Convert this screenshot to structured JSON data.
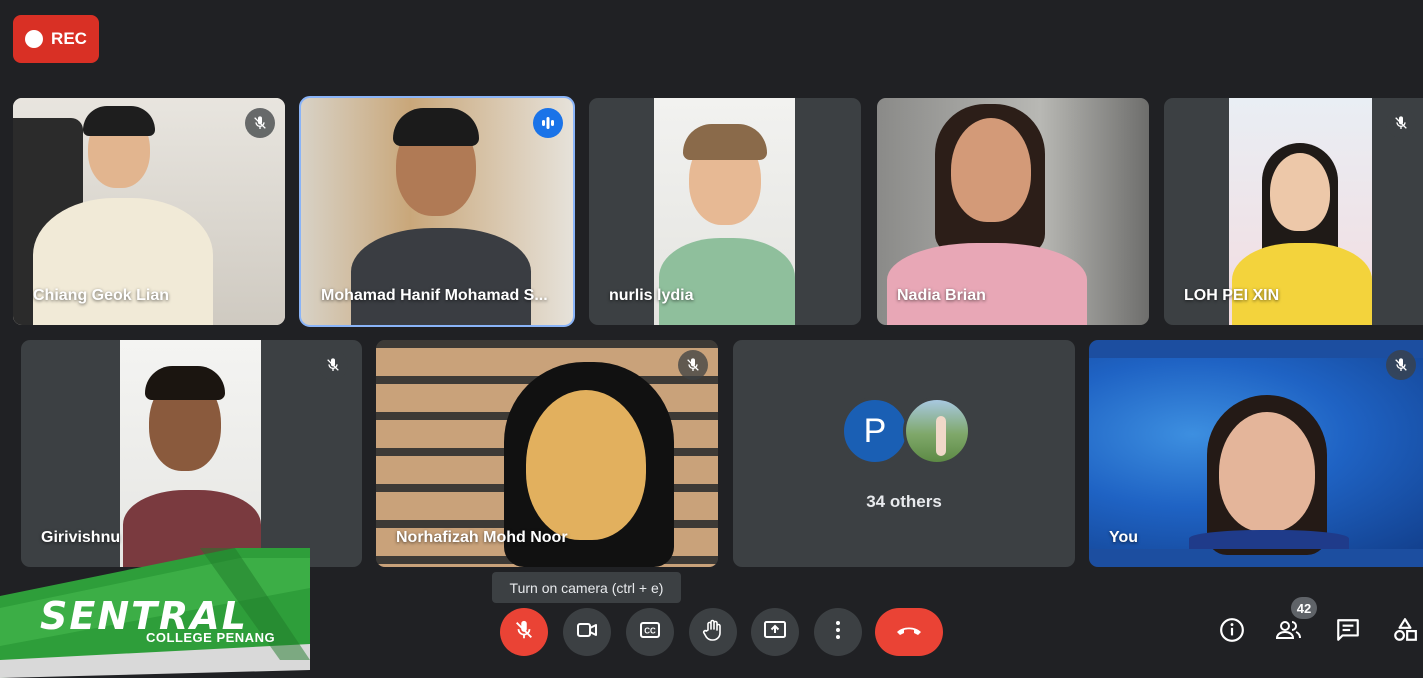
{
  "recording": {
    "label": "REC"
  },
  "participants": [
    {
      "name": "Chiang Geok Lian",
      "muted": true
    },
    {
      "name": "Mohamad Hanif Mohamad S...",
      "speaking": true
    },
    {
      "name": "nurlis lydia",
      "muted": false
    },
    {
      "name": "Nadia Brian",
      "muted": false
    },
    {
      "name": "LOH PEI XIN",
      "muted": true
    },
    {
      "name": "Girivishnu",
      "muted": true
    },
    {
      "name": "Norhafizah Mohd Noor",
      "muted": true
    },
    {
      "name": "You",
      "muted": true
    }
  ],
  "others": {
    "avatar_letter": "P",
    "label": "34 others"
  },
  "tooltip": {
    "text": "Turn on camera (ctrl + e)"
  },
  "controls": {
    "mic": "mic-off-icon",
    "camera": "camera-off-icon",
    "captions": "captions-icon",
    "raise_hand": "hand-icon",
    "present": "present-icon",
    "more": "more-vert-icon",
    "leave": "end-call-icon"
  },
  "side_controls": {
    "people_count": "42"
  },
  "branding": {
    "name": "SENTRAL",
    "sub": "COLLEGE PENANG"
  },
  "colors": {
    "background": "#202124",
    "tile": "#3c4043",
    "red": "#ea4335",
    "speaking": "#8ab4f8",
    "brand_green": "#2e9e3a"
  }
}
